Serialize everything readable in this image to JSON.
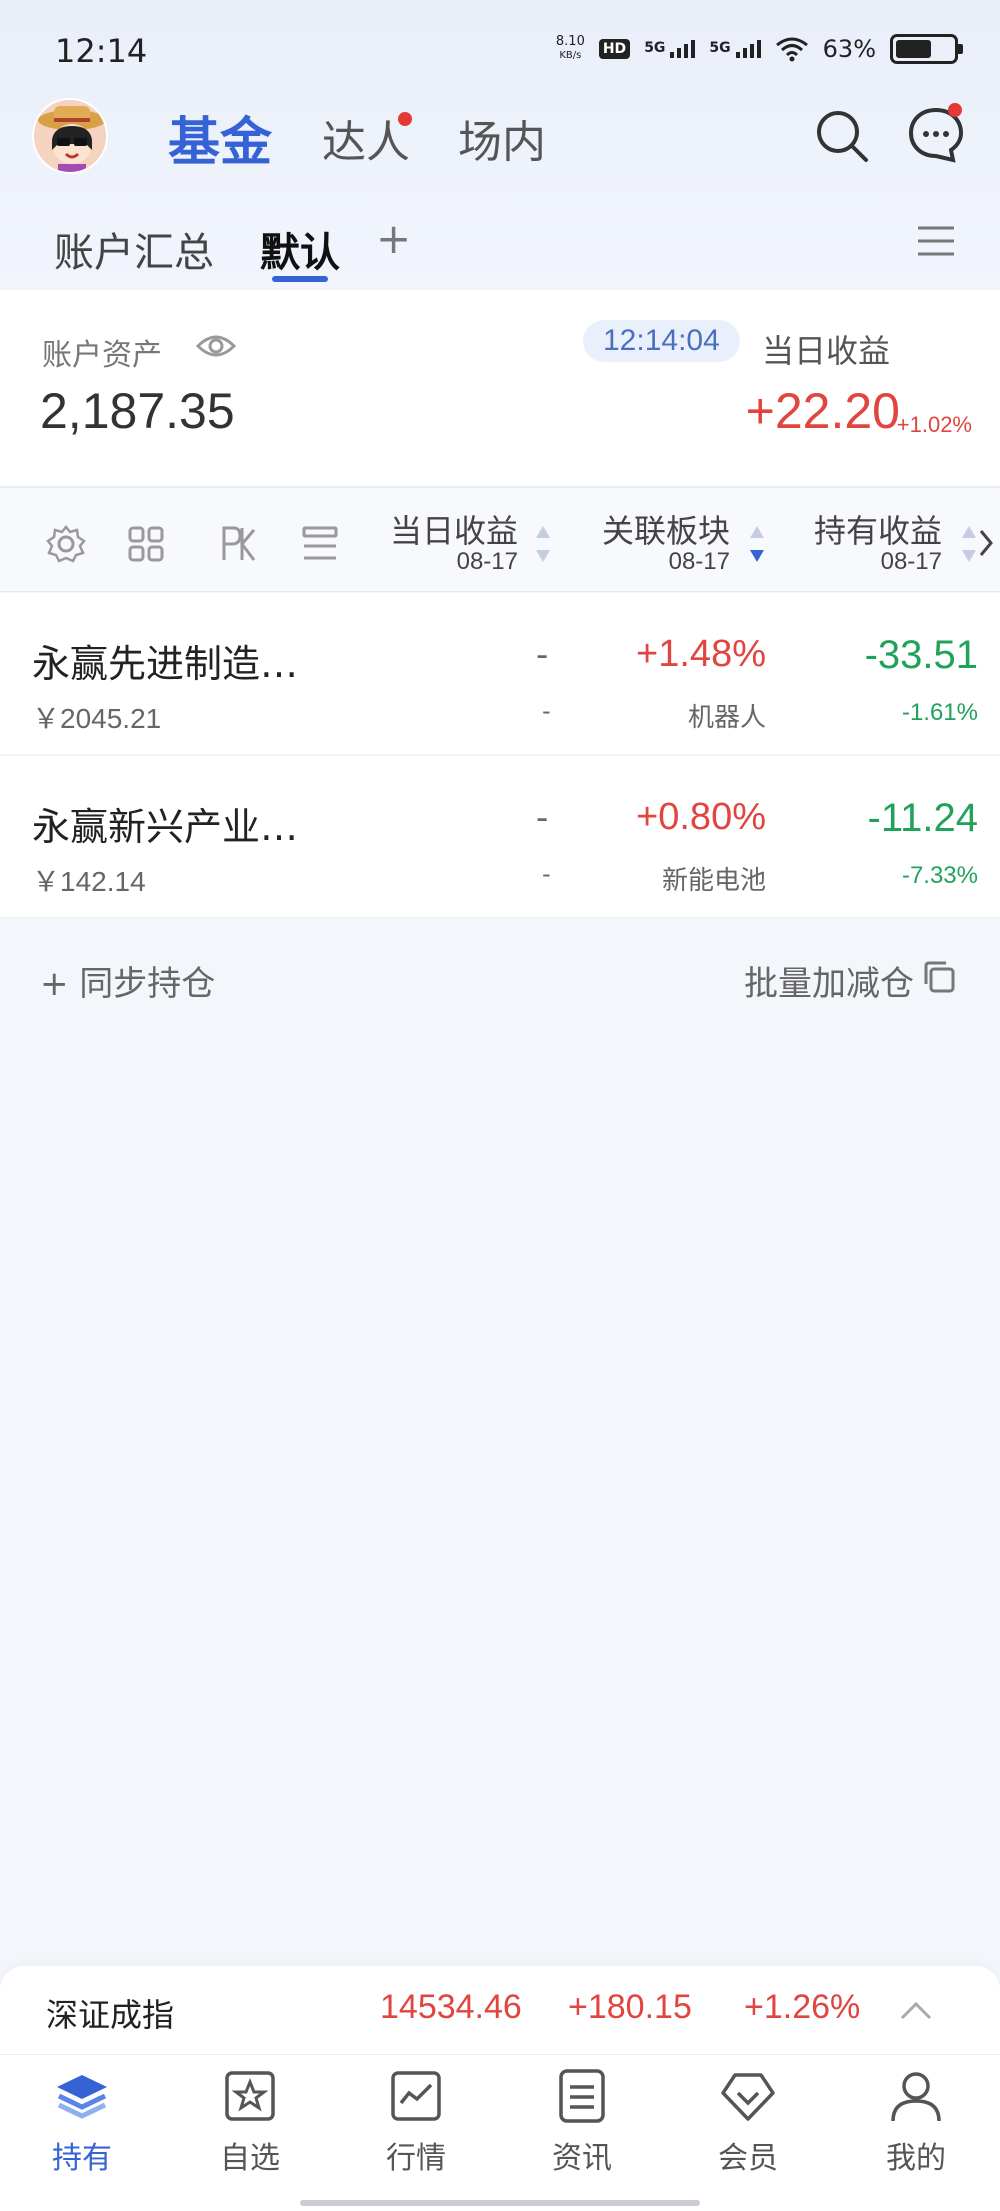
{
  "status_bar": {
    "time": "12:14",
    "net_speed_value": "8.10",
    "net_speed_unit": "KB/s",
    "hd_label": "HD",
    "sim1": "5G",
    "sim2": "5G",
    "battery": "63%"
  },
  "header": {
    "tabs": [
      {
        "label": "基金",
        "active": true
      },
      {
        "label": "达人",
        "has_dot": true
      },
      {
        "label": "场内"
      }
    ],
    "icons": [
      "search-icon",
      "message-icon"
    ]
  },
  "sub_tabs": {
    "items": [
      {
        "label": "账户汇总"
      },
      {
        "label": "默认",
        "active": true
      }
    ],
    "add": "+",
    "menu_icon": "menu-icon"
  },
  "summary": {
    "asset_label": "账户资产",
    "asset_value": "2,187.35",
    "time": "12:14:04",
    "day_label": "当日收益",
    "day_value": "+22.20",
    "day_pct": "+1.02%"
  },
  "columns": [
    {
      "title": "当日收益",
      "date": "08-17"
    },
    {
      "title": "关联板块",
      "date": "08-17"
    },
    {
      "title": "持有收益",
      "date": "08-17"
    }
  ],
  "holdings": [
    {
      "name": "永赢先进制造…",
      "amount": "￥2045.21",
      "day_big": "-",
      "day_small": "-",
      "sector_pct": "+1.48%",
      "sector": "机器人",
      "hold_value": "-33.51",
      "hold_pct": "-1.61%"
    },
    {
      "name": "永赢新兴产业…",
      "amount": "￥142.14",
      "day_big": "-",
      "day_small": "-",
      "sector_pct": "+0.80%",
      "sector": "新能电池",
      "hold_value": "-11.24",
      "hold_pct": "-7.33%"
    }
  ],
  "actions": {
    "sync": "+ 同步持仓",
    "batch": "批量加减仓"
  },
  "ticker": {
    "name": "深证成指",
    "value": "14534.46",
    "change": "+180.15",
    "change_pct": "+1.26%"
  },
  "bottom_nav": [
    {
      "label": "持有",
      "icon": "stack-icon",
      "active": true
    },
    {
      "label": "自选",
      "icon": "star-icon"
    },
    {
      "label": "行情",
      "icon": "chart-icon"
    },
    {
      "label": "资讯",
      "icon": "news-icon"
    },
    {
      "label": "会员",
      "icon": "diamond-icon"
    },
    {
      "label": "我的",
      "icon": "user-icon"
    }
  ],
  "colors": {
    "accent": "#3563d6",
    "up": "#e0453f",
    "down": "#20a25b"
  }
}
